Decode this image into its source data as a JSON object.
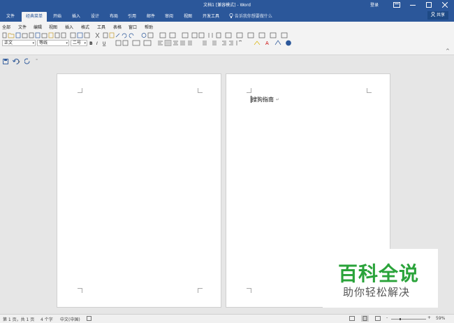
{
  "window": {
    "title": "文档1 [兼容模式] - Word",
    "login": "登录",
    "buttons": [
      "ribbon-display-options",
      "minimize",
      "maximize",
      "close"
    ]
  },
  "tabs": {
    "items": [
      "文件",
      "经典菜单",
      "开始",
      "插入",
      "设计",
      "布局",
      "引用",
      "邮件",
      "审阅",
      "视图",
      "开发工具"
    ],
    "active": "经典菜单",
    "tell_me": "告诉我你想要做什么",
    "share": "共享"
  },
  "menubar": {
    "items": [
      "全部",
      "文件",
      "编辑",
      "视图",
      "插入",
      "格式",
      "工具",
      "表格",
      "窗口",
      "帮助"
    ]
  },
  "format": {
    "style": "正文",
    "font": "等线",
    "size": "二号"
  },
  "document": {
    "text": "搜狗指南"
  },
  "status": {
    "page": "第 1 页，共 1 页",
    "words": "4 个字",
    "language": "中文(中国)",
    "zoom": "59%"
  },
  "watermark": {
    "line1": "百科全说",
    "line2": "助你轻松解决"
  },
  "colors": {
    "title_bar": "#2b579a",
    "ribbon": "#f3f3f3",
    "workspace": "#e6e6e6",
    "watermark_green": "#2aa33a"
  }
}
